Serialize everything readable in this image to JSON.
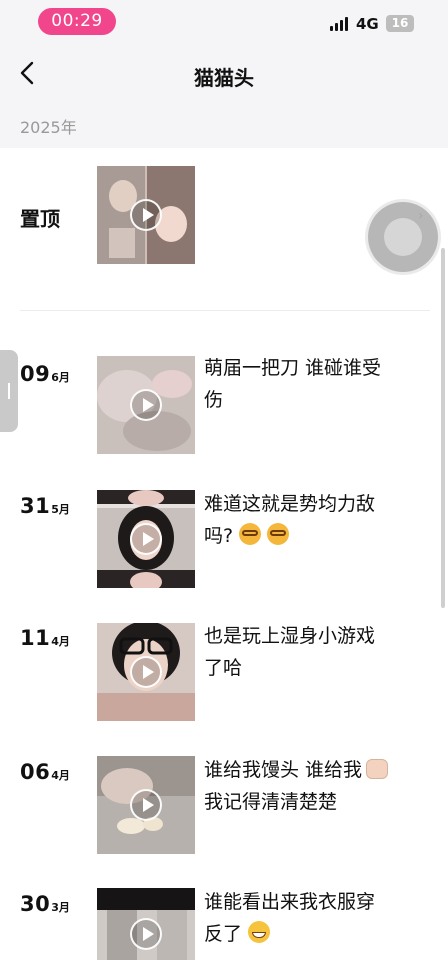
{
  "status": {
    "time": "00:29",
    "network": "4G",
    "battery": "16"
  },
  "header": {
    "title": "猫猫头"
  },
  "year_header": "2025年",
  "pinned": {
    "label": "置顶"
  },
  "posts": [
    {
      "day": "09",
      "month": "6月",
      "caption_line1": "萌届一把刀 谁碰谁受",
      "caption_line2": "伤"
    },
    {
      "day": "31",
      "month": "5月",
      "caption_line1": "难道这就是势均力敌",
      "caption_line2": "吗?"
    },
    {
      "day": "11",
      "month": "4月",
      "caption_line1": "也是玩上湿身小游戏",
      "caption_line2": "了哈"
    },
    {
      "day": "06",
      "month": "4月",
      "caption_line1": "谁给我馒头 谁给我",
      "caption_line2": "我记得清清楚楚"
    },
    {
      "day": "30",
      "month": "3月",
      "caption_line1": "谁能看出来我衣服穿",
      "caption_line2": "反了"
    }
  ],
  "colors": {
    "accent": "#f2468c",
    "header_bg": "#f5f4f6"
  },
  "icons": [
    "back-arrow-icon",
    "play-icon",
    "signal-icon",
    "chevron-right-icon"
  ]
}
